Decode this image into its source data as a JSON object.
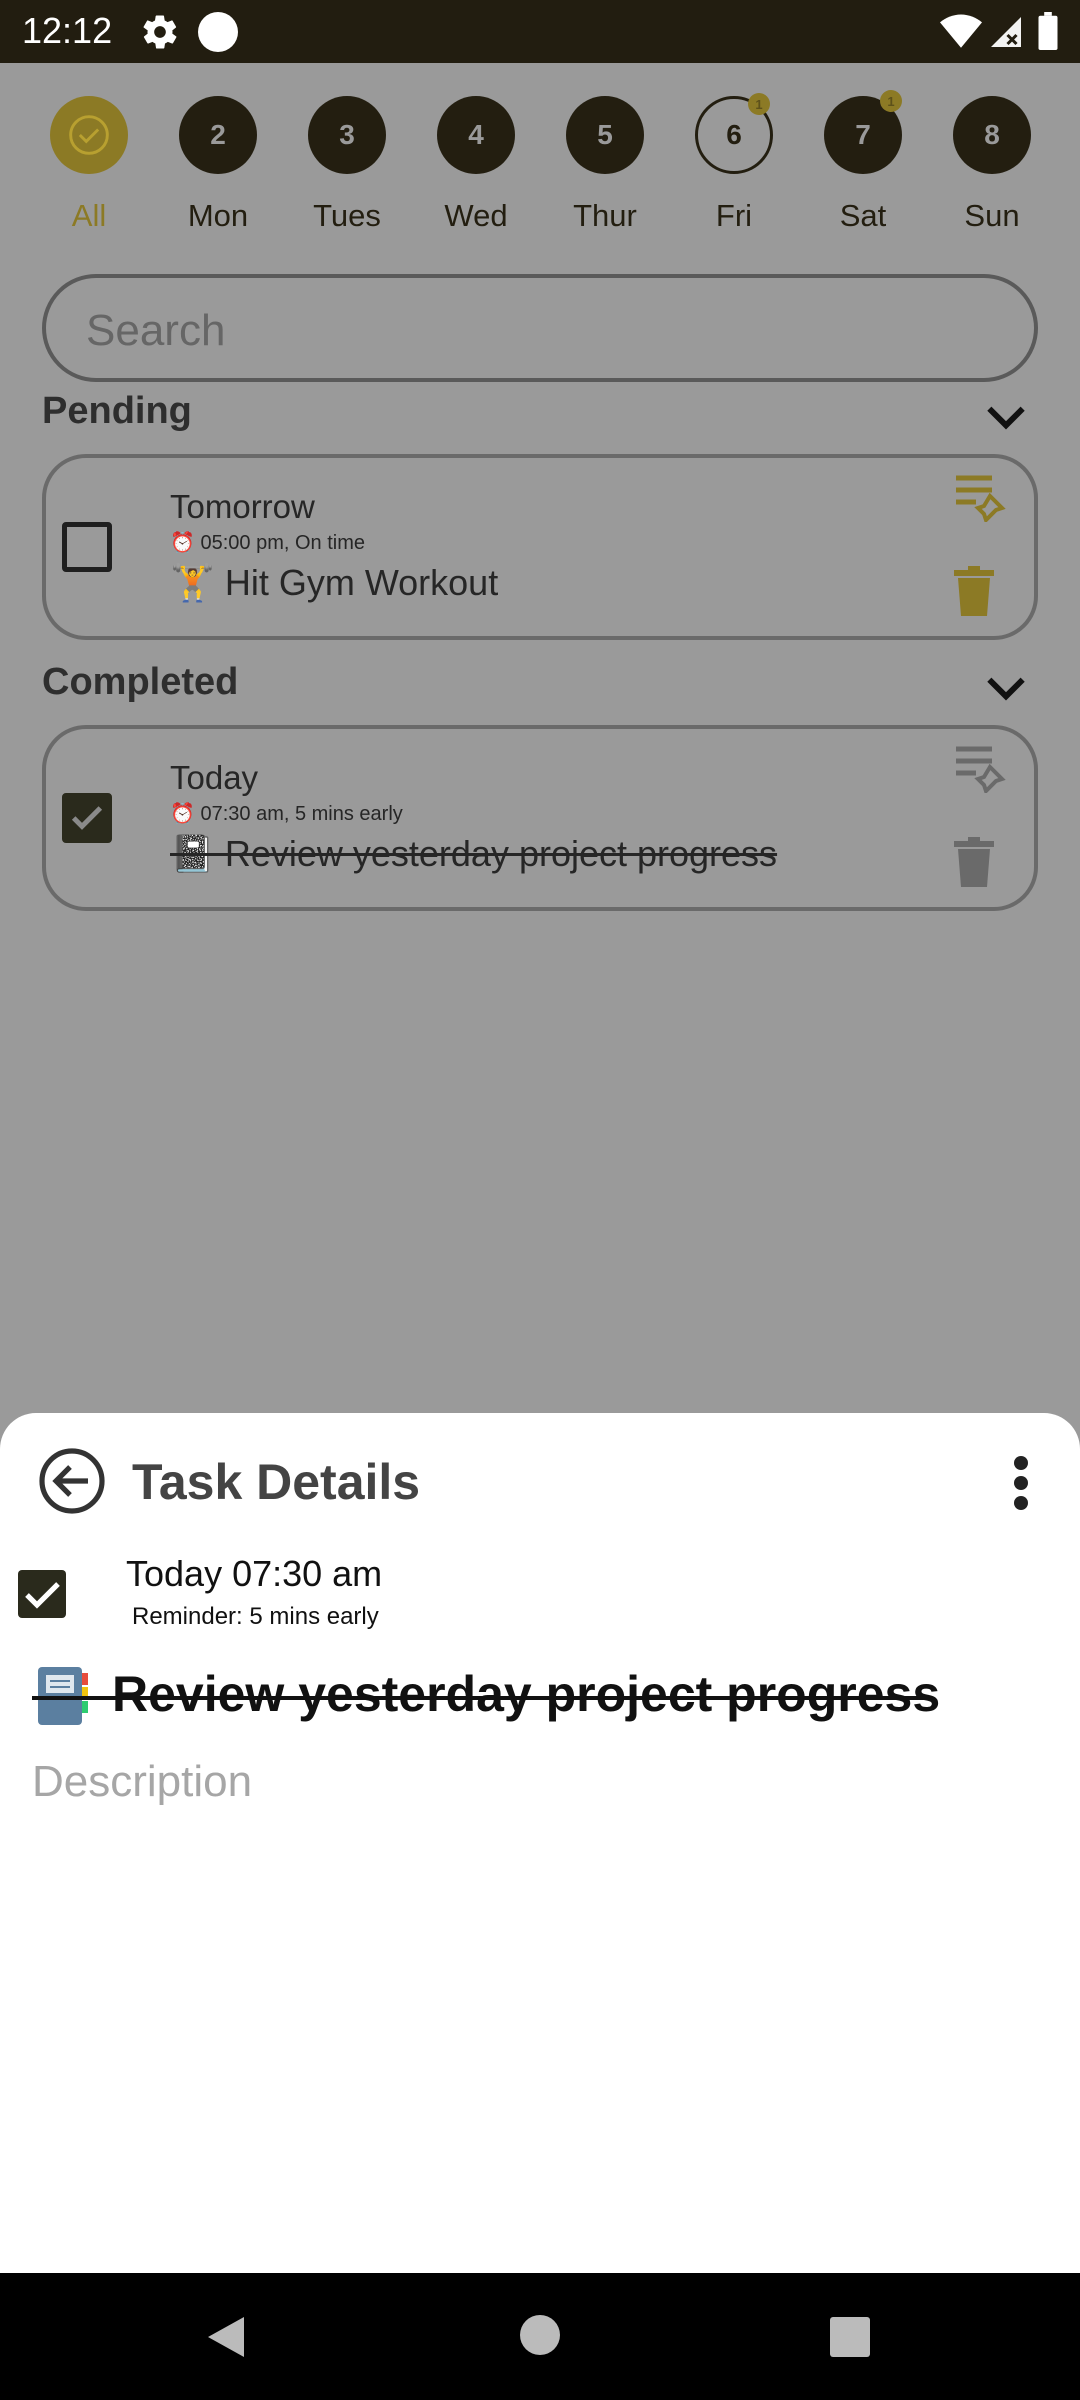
{
  "status_bar": {
    "time": "12:12",
    "icons": [
      "gear-icon",
      "dot-icon",
      "wifi-icon",
      "signal-icon",
      "battery-icon"
    ]
  },
  "days": [
    {
      "number": "",
      "label": "All",
      "icon": "check-circle-icon",
      "selected": true,
      "badge": ""
    },
    {
      "number": "2",
      "label": "Mon",
      "badge": ""
    },
    {
      "number": "3",
      "label": "Tues",
      "badge": ""
    },
    {
      "number": "4",
      "label": "Wed",
      "badge": ""
    },
    {
      "number": "5",
      "label": "Thur",
      "badge": ""
    },
    {
      "number": "6",
      "label": "Fri",
      "today": true,
      "badge": "1"
    },
    {
      "number": "7",
      "label": "Sat",
      "badge": "1"
    },
    {
      "number": "8",
      "label": "Sun",
      "badge": ""
    }
  ],
  "search": {
    "placeholder": "Search"
  },
  "sections": {
    "pending": {
      "title": "Pending",
      "task": {
        "day": "Tomorrow",
        "meta": "05:00 pm, On time",
        "title": "🏋️ Hit Gym Workout",
        "checked": false
      }
    },
    "completed": {
      "title": "Completed",
      "task": {
        "day": "Today",
        "meta": "07:30 am, 5 mins early",
        "title": "📓 Review yesterday project progress",
        "checked": true
      }
    }
  },
  "task_details": {
    "title": "Task Details",
    "when": "Today 07:30 am",
    "reminder": "Reminder: 5 mins early",
    "task_title": "Review yesterday project progress",
    "description_placeholder": "Description",
    "completed": true
  },
  "colors": {
    "accent": "#f0d040",
    "dark": "#231e10",
    "overlay": "#9a9a9a"
  }
}
